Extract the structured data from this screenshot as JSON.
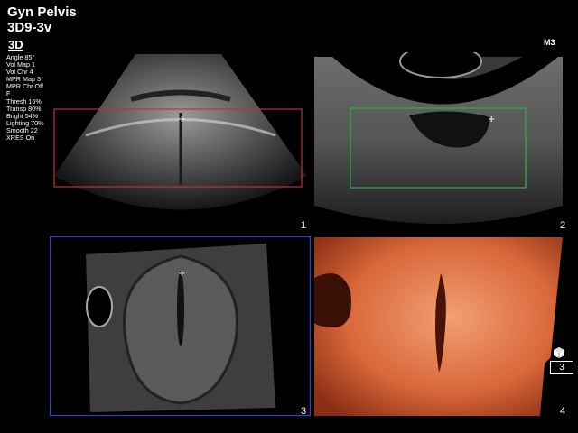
{
  "header": {
    "exam": "Gyn Pelvis",
    "probe": "3D9-3v",
    "mode": "3D",
    "right_label": "M3"
  },
  "params": [
    "Angle 85°",
    "Vol Map 1",
    "Vol Chr  4",
    "MPR Map 3",
    "MPR Chr Off",
    " F",
    "Thresh 16%",
    "Transp 80%",
    "Bright 54%",
    "Lighting 70%",
    "Smooth 22",
    "XRES On"
  ],
  "quadrants": [
    {
      "label": "1"
    },
    {
      "label": "2"
    },
    {
      "label": "3"
    },
    {
      "label": "4"
    }
  ],
  "badge": "3",
  "colors": {
    "roi_red": "#c0303a",
    "roi_green": "#2fb04a",
    "frame_blue": "#3040d0",
    "render_orange": "#e8764a"
  },
  "icons": [
    "cube-icon"
  ]
}
